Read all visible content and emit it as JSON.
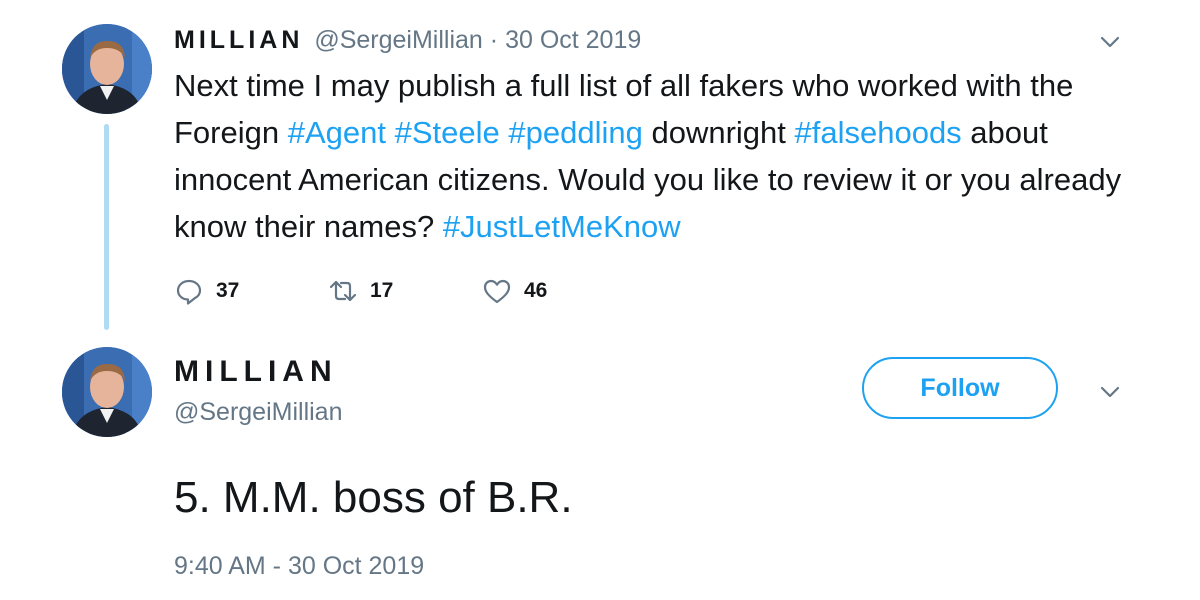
{
  "reply_tweet": {
    "author": {
      "display_name": "MILLIAN",
      "handle": "@SergeiMillian"
    },
    "separator": "·",
    "date": "30 Oct 2019",
    "text_segments": [
      {
        "text": "Next time I may publish a full list of all fakers who worked with the Foreign ",
        "hashtag": false
      },
      {
        "text": "#Agent",
        "hashtag": true
      },
      {
        "text": " ",
        "hashtag": false
      },
      {
        "text": "#Steele",
        "hashtag": true
      },
      {
        "text": " ",
        "hashtag": false
      },
      {
        "text": "#peddling",
        "hashtag": true
      },
      {
        "text": " downright ",
        "hashtag": false
      },
      {
        "text": "#falsehoods",
        "hashtag": true
      },
      {
        "text": " about innocent American citizens. Would you like to review it or you already know their names? ",
        "hashtag": false
      },
      {
        "text": "#JustLetMeKnow",
        "hashtag": true
      }
    ],
    "actions": {
      "replies": "37",
      "retweets": "17",
      "likes": "46"
    }
  },
  "main_tweet": {
    "author": {
      "display_name": "MILLIAN",
      "handle": "@SergeiMillian"
    },
    "follow_label": "Follow",
    "text": "5. M.M. boss of B.R.",
    "timestamp": "9:40 AM - 30 Oct 2019"
  },
  "icons": {
    "reply": "reply-icon",
    "retweet": "retweet-icon",
    "like": "heart-icon",
    "menu": "chevron-down-icon"
  },
  "colors": {
    "link": "#1da1f2",
    "secondary_text": "#657786",
    "primary_text": "#14171a",
    "thread_line": "#b1daf5"
  }
}
